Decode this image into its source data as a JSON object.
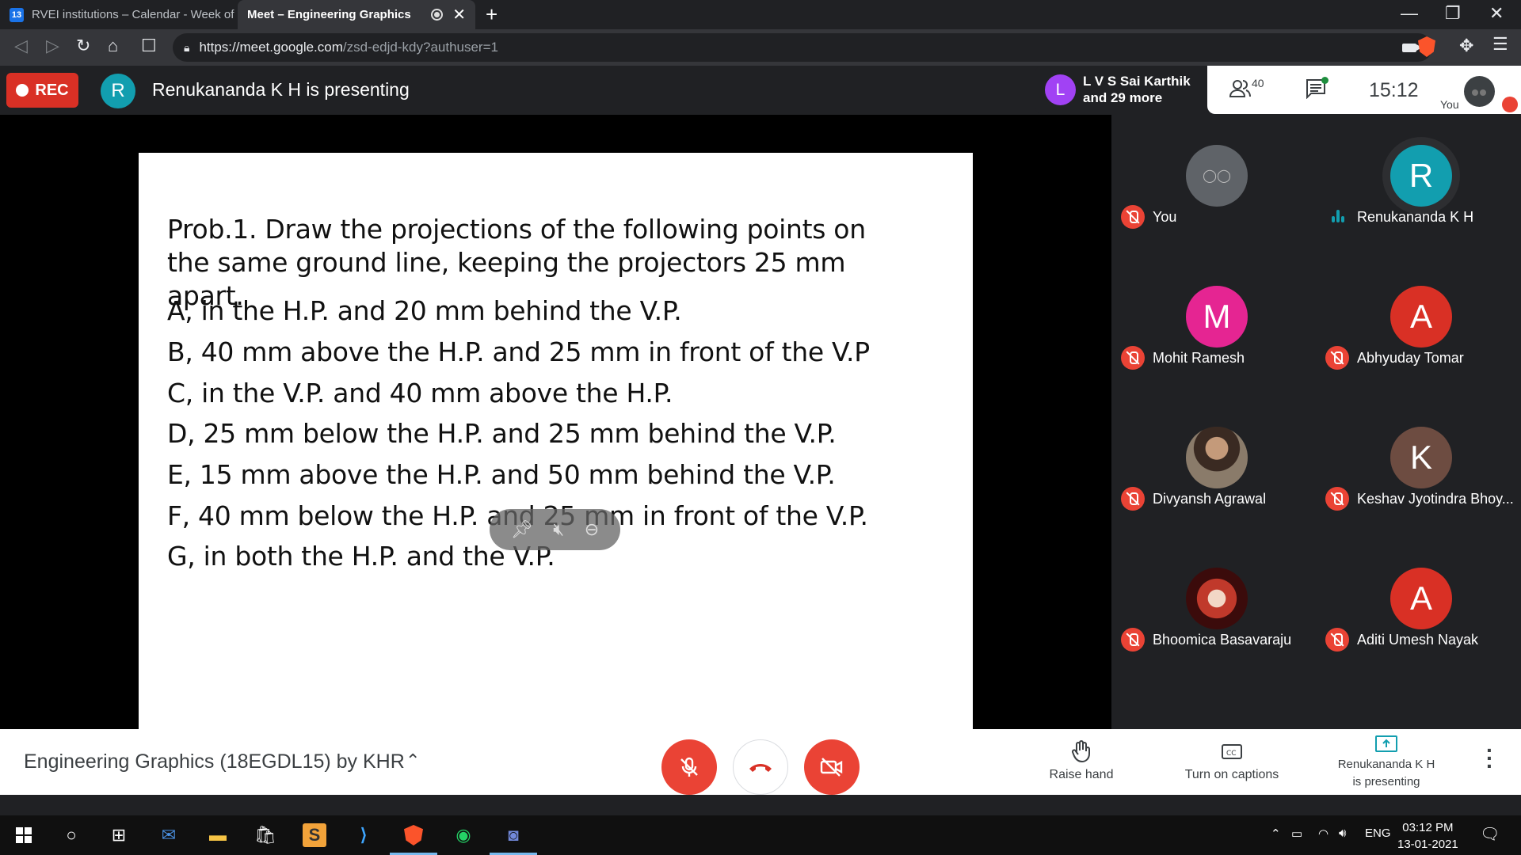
{
  "browser": {
    "tabs": [
      {
        "favicon_text": "13",
        "title": "RVEI institutions – Calendar - Week of",
        "active": false
      },
      {
        "title": "Meet – Engineering Graphics",
        "active": true
      }
    ],
    "url_host": "https://meet.google.com",
    "url_path": "/zsd-edjd-kdy?authuser=1"
  },
  "meet": {
    "rec_label": "REC",
    "presenter_initial": "R",
    "presenting_text": "Renukananda K H is presenting",
    "speaker_initial": "L",
    "speaker_name": "L V S Sai Karthik",
    "speaker_more": "and 29 more",
    "people_count": "40",
    "clock": "15:12",
    "self_label": "You",
    "colors": {
      "red": "#ea4335",
      "teal": "#129eaf",
      "purple": "#a142f4"
    }
  },
  "slide": {
    "problem": "Prob.1. Draw the projections of the following points on the same ground line, keeping the projectors 25 mm apart.",
    "items": [
      "A, in the H.P. and 20 mm behind the V.P.",
      "B, 40 mm above the H.P. and 25 mm in front of the V.P",
      "C, in the V.P. and 40 mm above the H.P.",
      "D, 25 mm below the H.P. and 25 mm behind the V.P.",
      "E, 15 mm above the H.P. and 50 mm behind the V.P.",
      "F, 40 mm below the H.P. and 25 mm in front of the V.P.",
      "G, in both the H.P. and the V.P."
    ]
  },
  "participants": [
    {
      "name": "You",
      "initial": "",
      "color": "#5f6368",
      "muted": true
    },
    {
      "name": "Renukananda K H",
      "initial": "R",
      "color": "#129eaf",
      "muted": false
    },
    {
      "name": "Mohit Ramesh",
      "initial": "M",
      "color": "#e52592",
      "muted": true
    },
    {
      "name": "Abhyuday Tomar",
      "initial": "A",
      "color": "#d93025",
      "muted": true
    },
    {
      "name": "Divyansh Agrawal",
      "initial": "",
      "color": "#8d6e63",
      "muted": true
    },
    {
      "name": "Keshav Jyotindra Bhoy...",
      "initial": "K",
      "color": "#6d4c41",
      "muted": true
    },
    {
      "name": "Bhoomica Basavaraju",
      "initial": "",
      "color": "#8e1b1b",
      "muted": true
    },
    {
      "name": "Aditi Umesh Nayak",
      "initial": "A",
      "color": "#d93025",
      "muted": true
    }
  ],
  "bottom": {
    "meeting_title": "Engineering Graphics (18EGDL15) by KHR",
    "raise_hand": "Raise hand",
    "captions": "Turn on captions",
    "presenting_line1": "Renukananda K H",
    "presenting_line2": "is presenting"
  },
  "taskbar": {
    "lang": "ENG",
    "time": "03:12 PM",
    "date": "13-01-2021"
  }
}
